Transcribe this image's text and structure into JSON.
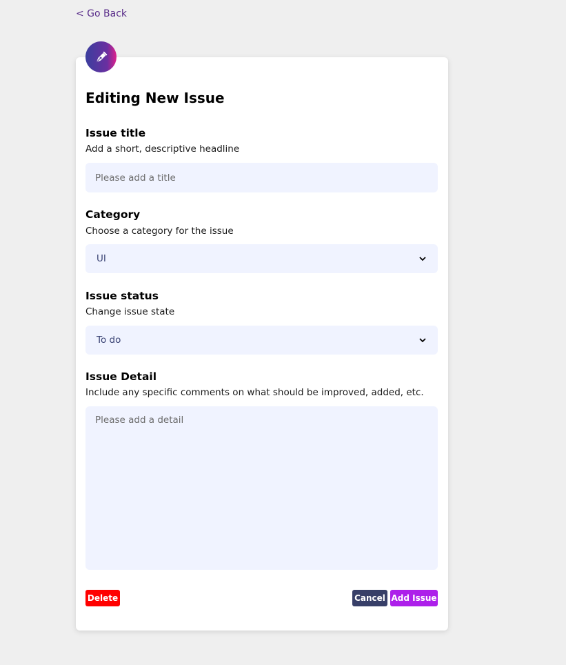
{
  "nav": {
    "go_back": "< Go Back"
  },
  "badge": {
    "icon": "pen-nib-icon"
  },
  "page_title": "Editing New Issue",
  "fields": {
    "title": {
      "label": "Issue title",
      "description": "Add a short, descriptive headline",
      "placeholder": "Please add a title"
    },
    "category": {
      "label": "Category",
      "description": "Choose a category for the issue",
      "value": "UI"
    },
    "status": {
      "label": "Issue status",
      "description": "Change issue state",
      "value": "To do"
    },
    "detail": {
      "label": "Issue Detail",
      "description": "Include any specific comments on what should be improved, added, etc.",
      "placeholder": "Please add a detail"
    }
  },
  "actions": {
    "delete": "Delete",
    "cancel": "Cancel",
    "add": "Add Issue"
  },
  "colors": {
    "background": "#efefef",
    "card": "#ffffff",
    "input_bg": "#f0f3ff",
    "link": "#5a2e8a",
    "delete": "#ff0000",
    "cancel": "#373f68",
    "add": "#ad1fea"
  }
}
